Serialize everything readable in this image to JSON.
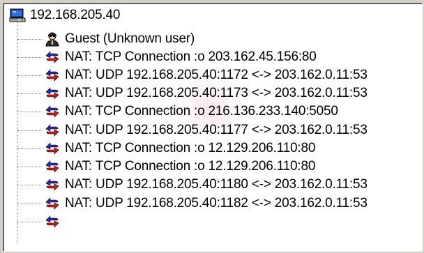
{
  "tree": {
    "root": {
      "label": "192.168.205.40",
      "icon": "computer-icon"
    },
    "items": [
      {
        "label": "Guest (Unknown user)",
        "icon": "user-icon"
      },
      {
        "label": "NAT: TCP Connection :o 203.162.45.156:80",
        "icon": "nat-arrows-icon"
      },
      {
        "label": "NAT: UDP 192.168.205.40:1172 <-> 203.162.0.11:53",
        "icon": "nat-arrows-icon"
      },
      {
        "label": "NAT: UDP 192.168.205.40:1173 <-> 203.162.0.11:53",
        "icon": "nat-arrows-icon"
      },
      {
        "label": "NAT: TCP Connection :o 216.136.233.140:5050",
        "icon": "nat-arrows-icon"
      },
      {
        "label": "NAT: UDP 192.168.205.40:1177 <-> 203.162.0.11:53",
        "icon": "nat-arrows-icon"
      },
      {
        "label": "NAT: TCP Connection :o 12.129.206.110:80",
        "icon": "nat-arrows-icon"
      },
      {
        "label": "NAT: TCP Connection :o 12.129.206.110:80",
        "icon": "nat-arrows-icon"
      },
      {
        "label": "NAT: UDP 192.168.205.40:1180 <-> 203.162.0.11:53",
        "icon": "nat-arrows-icon"
      },
      {
        "label": "NAT: UDP 192.168.205.40:1182 <-> 203.162.0.11:53",
        "icon": "nat-arrows-icon"
      }
    ]
  },
  "colors": {
    "nat_red": "#cc1a1a",
    "nat_blue": "#2a2aa8",
    "computer_blue": "#1f3fa0"
  }
}
